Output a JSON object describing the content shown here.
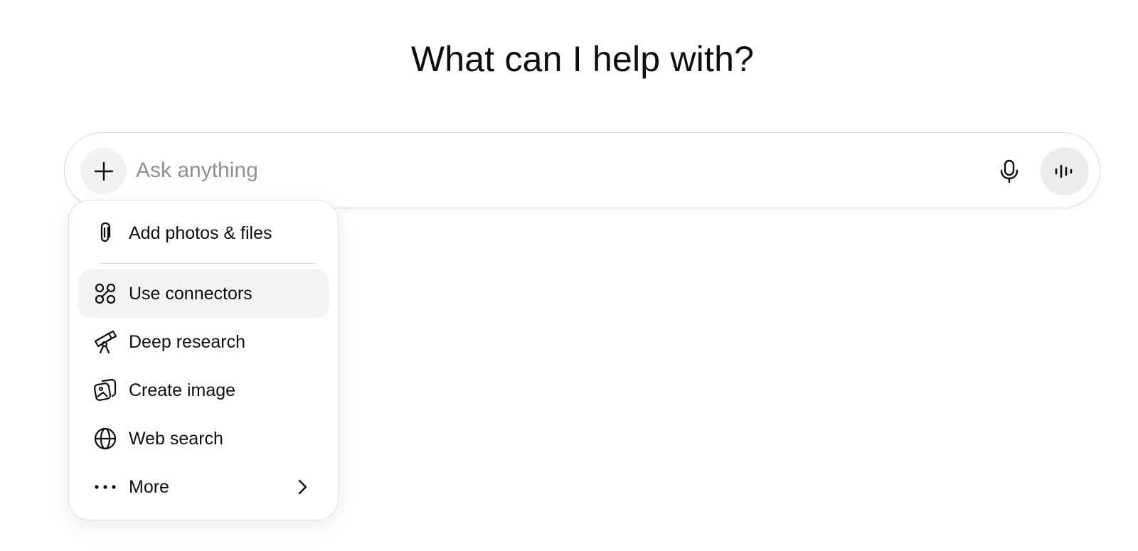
{
  "heading": "What can I help with?",
  "composer": {
    "placeholder": "Ask anything",
    "value": ""
  },
  "menu": {
    "items": [
      {
        "label": "Add photos & files",
        "icon": "paperclip-icon"
      },
      {
        "label": "Use connectors",
        "icon": "connectors-icon",
        "highlighted": true
      },
      {
        "label": "Deep research",
        "icon": "telescope-icon"
      },
      {
        "label": "Create image",
        "icon": "image-icon"
      },
      {
        "label": "Web search",
        "icon": "globe-icon"
      },
      {
        "label": "More",
        "icon": "ellipsis-icon",
        "submenu": true
      }
    ]
  },
  "colors": {
    "text": "#0d0d0d",
    "placeholder": "#8f8f8f",
    "button_bg": "#f1f1f1",
    "highlight_bg": "#f3f3f3",
    "border": "#d9d9d9"
  }
}
